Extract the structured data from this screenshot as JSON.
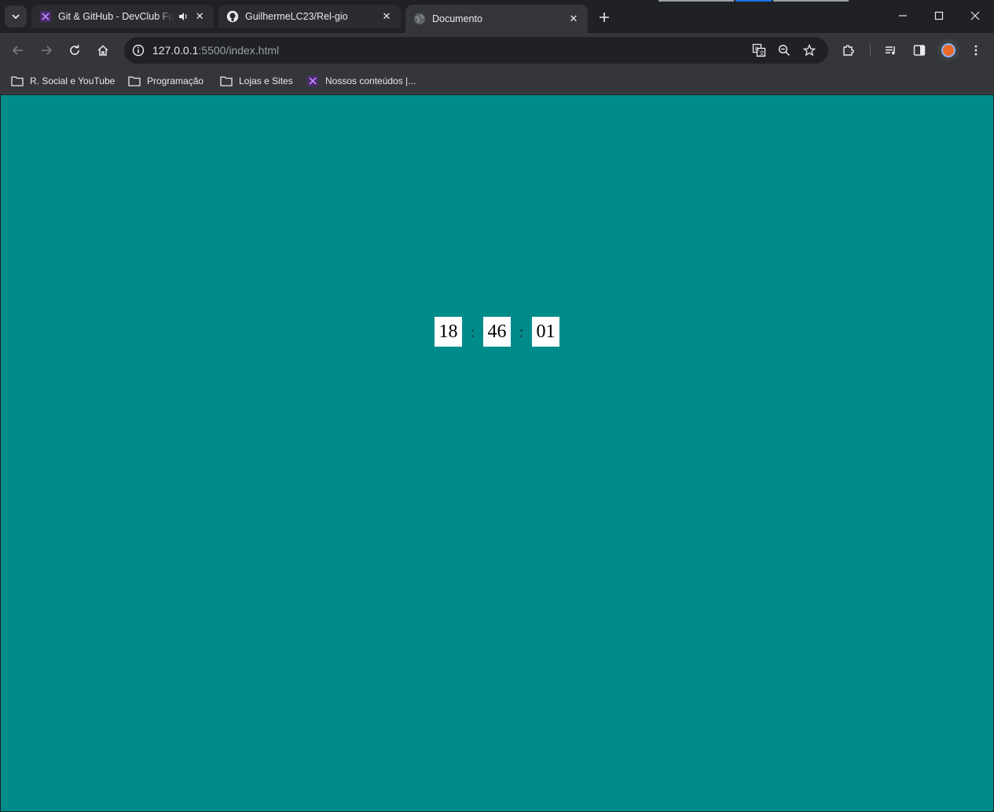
{
  "tabs": [
    {
      "title": "Git & GitHub - DevClub Full",
      "icon": "devclub-icon",
      "audio": true
    },
    {
      "title": "GuilhermeLC23/Rel-gio",
      "icon": "github-icon",
      "audio": false
    },
    {
      "title": "Documento",
      "icon": "globe-icon",
      "audio": false,
      "active": true
    }
  ],
  "address_bar": {
    "host": "127.0.0.1",
    "path": ":5500/index.html"
  },
  "bookmarks": [
    {
      "label": "R. Social e YouTube",
      "icon": "folder-icon"
    },
    {
      "label": "Programação",
      "icon": "folder-icon"
    },
    {
      "label": "Lojas e Sites",
      "icon": "folder-icon"
    },
    {
      "label": "Nossos conteúdos |...",
      "icon": "devclub-icon"
    }
  ],
  "clock": {
    "hours": "18",
    "minutes": "46",
    "seconds": "01",
    "separator": ":"
  },
  "colors": {
    "page_background": "#008b8b",
    "browser_frame": "#202124",
    "toolbar": "#35363a",
    "digit_background": "#ffffff"
  }
}
